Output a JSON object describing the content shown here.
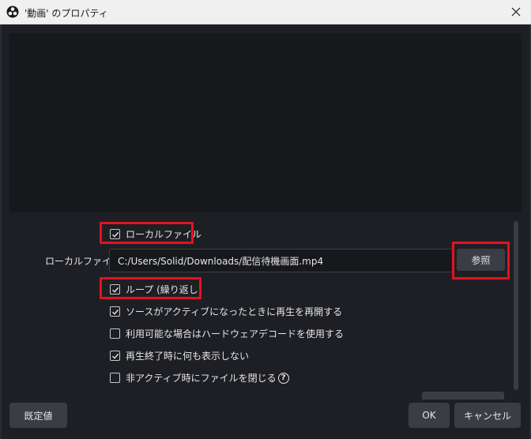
{
  "window": {
    "title": "'動画' のプロパティ",
    "close_icon": "close-icon",
    "app_icon": "obs-logo-icon"
  },
  "properties": {
    "local_file_checkbox": {
      "label": "ローカルファイル",
      "checked": true
    },
    "local_file_field": {
      "label": "ローカルファイル",
      "value": "C:/Users/Solid/Downloads/配信待機画面.mp4"
    },
    "browse_button": {
      "label": "参照"
    },
    "options": [
      {
        "label": "ループ (繰り返し)",
        "checked": true
      },
      {
        "label": "ソースがアクティブになったときに再生を再開する",
        "checked": true
      },
      {
        "label": "利用可能な場合はハードウェアデコードを使用する",
        "checked": false
      },
      {
        "label": "再生終了時に何も表示しない",
        "checked": true
      },
      {
        "label": "非アクティブ時にファイルを閉じる",
        "checked": false,
        "help_icon": "?"
      }
    ]
  },
  "footer": {
    "defaults_label": "既定値",
    "ok_label": "OK",
    "cancel_label": "キャンセル"
  },
  "colors": {
    "highlight": "#e3121f",
    "background": "#1e1f24",
    "button": "#3b3d45"
  }
}
